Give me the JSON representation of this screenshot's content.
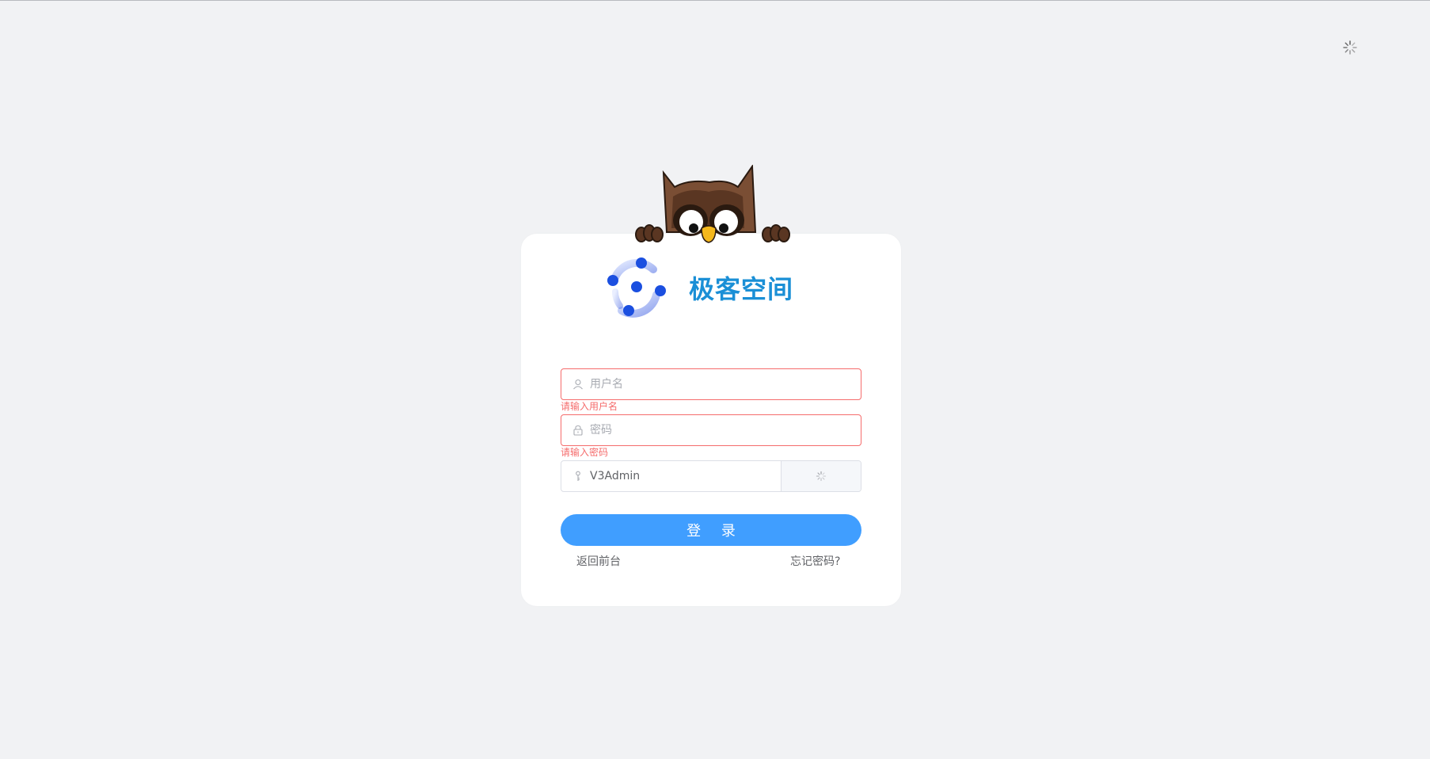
{
  "brand": {
    "title": "极客空间",
    "title_color": "#1a8fd6",
    "logo_icon": "dots-ring-logo-icon",
    "mascot_icon": "owl-mascot-icon"
  },
  "header": {
    "theme_toggle_icon": "loading-spinner-icon"
  },
  "form": {
    "username": {
      "placeholder": "用户名",
      "value": "",
      "icon": "user-icon",
      "error": "请输入用户名"
    },
    "password": {
      "placeholder": "密码",
      "value": "",
      "icon": "lock-icon",
      "error": "请输入密码"
    },
    "captcha": {
      "value": "V3Admin",
      "icon": "key-icon",
      "image_icon": "loading-spinner-icon"
    },
    "login_label": "登 录",
    "back_link": "返回前台",
    "forgot_link": "忘记密码?"
  },
  "colors": {
    "primary": "#409eff",
    "error": "#f56c6c",
    "background": "#f1f2f4"
  }
}
